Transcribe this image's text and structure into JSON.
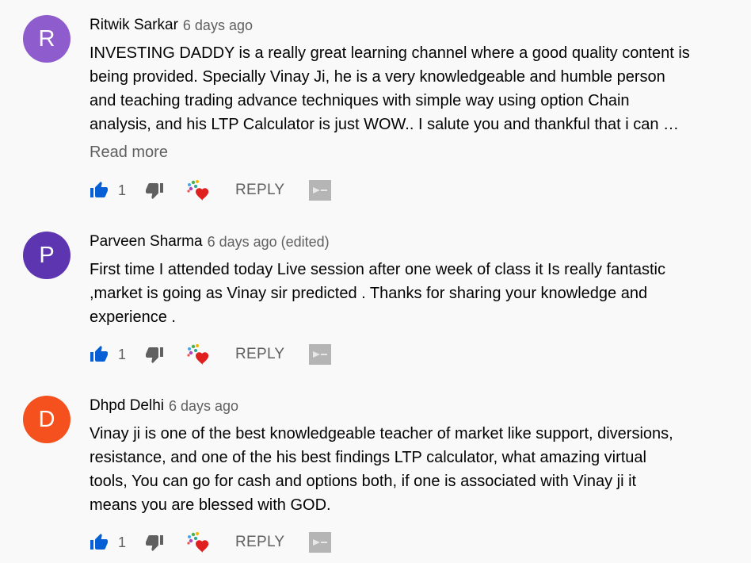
{
  "comments": [
    {
      "avatar_letter": "R",
      "avatar_color": "#8e5ccc",
      "author": "Ritwik Sarkar",
      "date": "6 days ago",
      "lines": [
        "INVESTING DADDY is a really great learning channel where a good quality content is",
        "being provided.  Specially Vinay Ji, he is a very knowledgeable and humble person",
        "and teaching trading advance techniques with simple way using option Chain",
        "analysis, and his LTP Calculator is just WOW.. I salute you and thankful that i can …"
      ],
      "read_more": "Read more",
      "likes": "1",
      "reply_label": "REPLY"
    },
    {
      "avatar_letter": "P",
      "avatar_color": "#5e35b1",
      "author": "Parveen Sharma",
      "date": "6 days ago (edited)",
      "lines": [
        "First time I attended today Live session after one week of class it Is really fantastic",
        ",market is going as Vinay sir predicted . Thanks for sharing your knowledge and",
        "experience ."
      ],
      "likes": "1",
      "reply_label": "REPLY"
    },
    {
      "avatar_letter": "D",
      "avatar_color": "#f4511e",
      "author": "Dhpd Delhi",
      "date": "6 days ago",
      "lines": [
        "Vinay ji is one of the best knowledgeable teacher of market like support, diversions,",
        "resistance, and one of the his  best findings LTP calculator, what amazing virtual",
        "tools, You can go for cash and options both, if one is associated with Vinay ji it",
        "means you are blessed with GOD."
      ],
      "likes": "1",
      "reply_label": "REPLY"
    }
  ],
  "colors": {
    "like_blue": "#065fd4",
    "icon_grey": "#606060",
    "heart_red": "#e0201f"
  },
  "icons": [
    "thumb-up-icon",
    "thumb-down-icon",
    "creator-heart-icon",
    "flag-icon"
  ]
}
